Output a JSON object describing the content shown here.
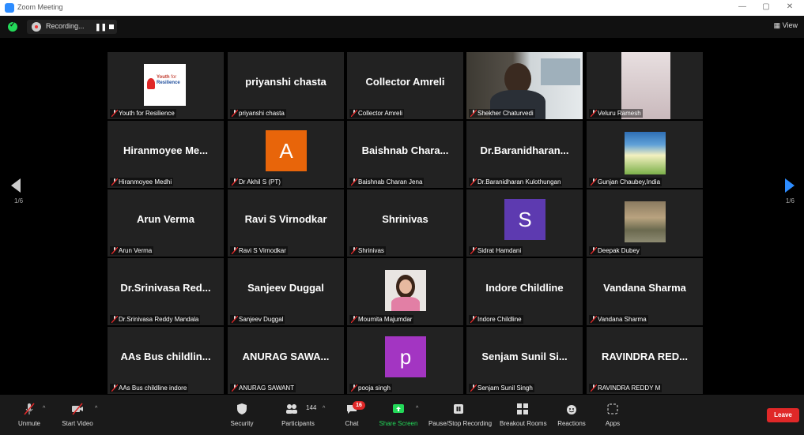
{
  "window": {
    "title": "Zoom Meeting"
  },
  "topbar": {
    "recording_label": "Recording...",
    "view_label": "View"
  },
  "pager": {
    "left": "1/6",
    "right": "1/6"
  },
  "tiles": [
    {
      "big": "",
      "label": "Youth for Resilience",
      "kind": "logo",
      "logo_line1": "Youth",
      "logo_line2": "for",
      "logo_line3": "Resilience"
    },
    {
      "big": "priyanshi chasta",
      "label": "priyanshi chasta",
      "kind": "name"
    },
    {
      "big": "Collector Amreli",
      "label": "Collector Amreli",
      "kind": "name"
    },
    {
      "big": "",
      "label": "Shekher Chaturvedi",
      "kind": "video"
    },
    {
      "big": "",
      "label": "Veluru Ramesh",
      "kind": "blurphoto"
    },
    {
      "big": "Hiranmoyee  Me...",
      "label": "Hiranmoyee Medhi",
      "kind": "name"
    },
    {
      "big": "",
      "label": "Dr Akhil S (PT)",
      "kind": "avatar",
      "letter": "A",
      "color": "#e8650a"
    },
    {
      "big": "Baishnab  Chara...",
      "label": "Baishnab Charan Jena",
      "kind": "name"
    },
    {
      "big": "Dr.Baranidharan...",
      "label": "Dr.Baranidharan Kulothungan",
      "kind": "name"
    },
    {
      "big": "",
      "label": "Gunjan Chaubey,India",
      "kind": "poster"
    },
    {
      "big": "Arun Verma",
      "label": "Arun Verma",
      "kind": "name"
    },
    {
      "big": "Ravi S Virnodkar",
      "label": "Ravi S Virnodkar",
      "kind": "name"
    },
    {
      "big": "Shrinivas",
      "label": "Shrinivas",
      "kind": "name"
    },
    {
      "big": "",
      "label": "Sidrat Hamdani",
      "kind": "avatar",
      "letter": "S",
      "color": "#5d3ab0"
    },
    {
      "big": "",
      "label": "Deepak Dubey",
      "kind": "photo"
    },
    {
      "big": "Dr.Srinivasa  Red...",
      "label": "Dr.Srinivasa Reddy Mandala",
      "kind": "name"
    },
    {
      "big": "Sanjeev Duggal",
      "label": "Sanjeev Duggal",
      "kind": "name"
    },
    {
      "big": "",
      "label": "Moumita Majumdar",
      "kind": "portrait"
    },
    {
      "big": "Indore Childline",
      "label": "Indore Childline",
      "kind": "name"
    },
    {
      "big": "Vandana Sharma",
      "label": "Vandana Sharma",
      "kind": "name"
    },
    {
      "big": "AAs  Bus  childlin...",
      "label": "AAs Bus childline indore",
      "kind": "name"
    },
    {
      "big": "ANURAG  SAWA...",
      "label": "ANURAG SAWANT",
      "kind": "name"
    },
    {
      "big": "",
      "label": "pooja singh",
      "kind": "avatar",
      "letter": "p",
      "color": "#a335c2"
    },
    {
      "big": "Senjam  Sunil  Si...",
      "label": "Senjam Sunil Singh",
      "kind": "name"
    },
    {
      "big": "RAVINDRA  RED...",
      "label": "RAVINDRA REDDY M",
      "kind": "name"
    }
  ],
  "toolbar": {
    "unmute": "Unmute",
    "start_video": "Start Video",
    "security": "Security",
    "participants": "Participants",
    "participants_count": "144",
    "chat": "Chat",
    "chat_badge": "16",
    "share_screen": "Share Screen",
    "pause_stop": "Pause/Stop Recording",
    "breakout": "Breakout Rooms",
    "reactions": "Reactions",
    "apps": "Apps",
    "leave": "Leave"
  },
  "colors": {
    "active_speaker": "#b0d243",
    "share_green": "#23d959",
    "leave_red": "#e02828",
    "zoom_blue": "#2d8cff"
  }
}
